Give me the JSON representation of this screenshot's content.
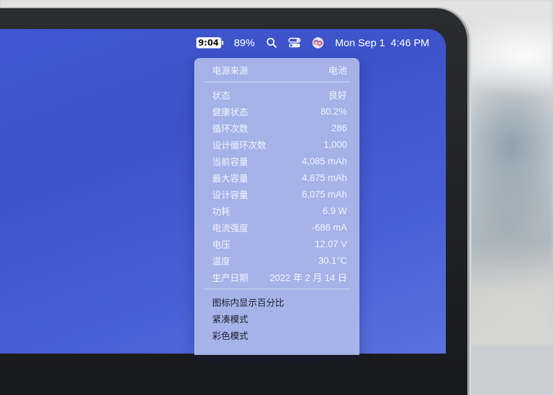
{
  "menubar": {
    "battery_time": "9:04",
    "battery_percent": "89%",
    "date": "Mon Sep 1",
    "time": "4:46 PM",
    "icons": [
      "search-icon",
      "control-center-icon",
      "siri-icon"
    ]
  },
  "battery_menu": {
    "header": {
      "label": "电源来源",
      "value": "电池"
    },
    "rows": [
      {
        "label": "状态",
        "value": "良好"
      },
      {
        "label": "健康状态",
        "value": "80.2%"
      },
      {
        "label": "循环次数",
        "value": "286"
      },
      {
        "label": "设计循环次数",
        "value": "1,000"
      },
      {
        "label": "当前容量",
        "value": "4,085 mAh"
      },
      {
        "label": "最大容量",
        "value": "4,875 mAh"
      },
      {
        "label": "设计容量",
        "value": "6,075 mAh"
      },
      {
        "label": "功耗",
        "value": "6.9 W"
      },
      {
        "label": "电流强度",
        "value": "-686 mA"
      },
      {
        "label": "电压",
        "value": "12.07 V"
      },
      {
        "label": "温度",
        "value": "30.1°C"
      },
      {
        "label": "生产日期",
        "value": "2022 年 2 月 14 日"
      }
    ],
    "actions": [
      "图标内显示百分比",
      "紧凑模式",
      "彩色模式"
    ]
  },
  "colors": {
    "desktop": "#3f57d0",
    "menu_bg": "#adb9ea"
  }
}
